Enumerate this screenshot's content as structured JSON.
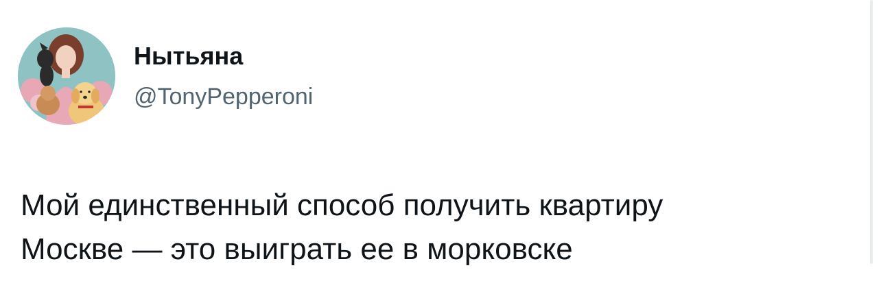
{
  "author": {
    "name": "Нытьяна",
    "handle": "@TonyPepperoni"
  },
  "tweet": {
    "lines": [
      "Мой единственный способ получить квартиру",
      "Москве — это выиграть ее в морковске"
    ]
  },
  "colors": {
    "text_primary": "#0f1419",
    "text_secondary": "#536471",
    "avatar_bg": "#8fc3c3"
  }
}
